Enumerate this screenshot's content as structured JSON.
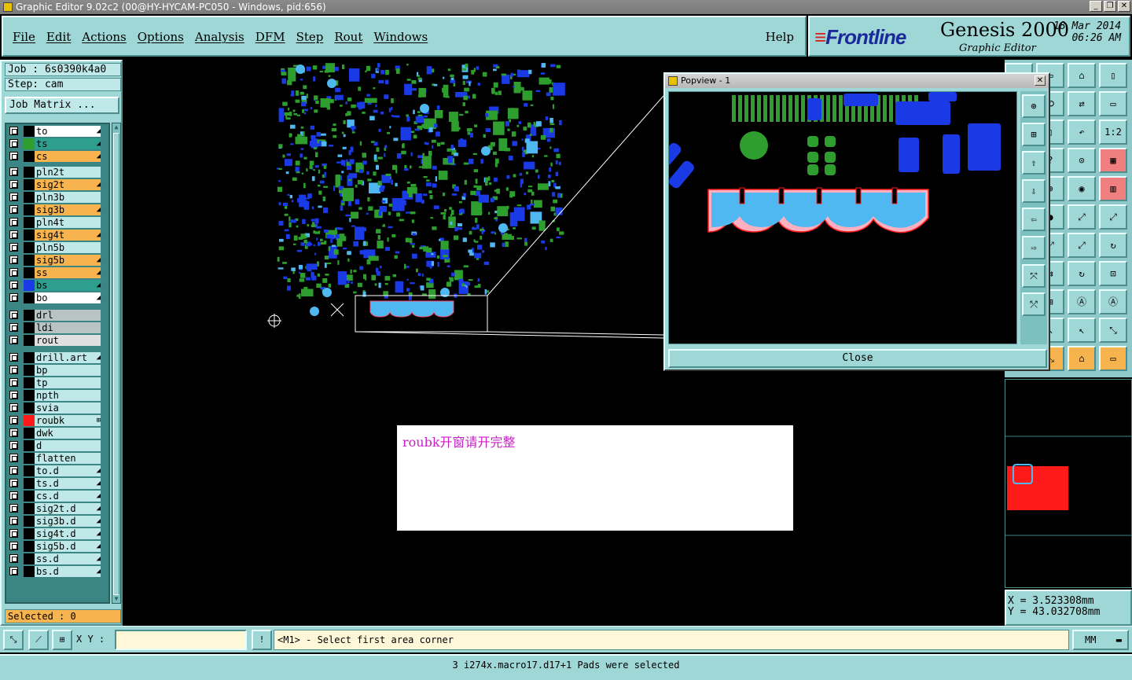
{
  "window": {
    "title": "Graphic Editor 9.02c2 (00@HY-HYCAM-PC050 - Windows, pid:656)"
  },
  "menu": {
    "items": [
      "File",
      "Edit",
      "Actions",
      "Options",
      "Analysis",
      "DFM",
      "Step",
      "Rout",
      "Windows"
    ],
    "help": "Help"
  },
  "brand": {
    "logo": "Frontline",
    "product": "Genesis 2000",
    "subtitle": "Graphic Editor",
    "date": "18 Mar 2014",
    "time": "06:26 AM"
  },
  "job": {
    "job_label": "Job : 6s0390k4a0",
    "step_label": "Step: cam",
    "matrix_button": "Job Matrix ..."
  },
  "layers": [
    {
      "name": "to",
      "color": "#ffffff",
      "swatch": "",
      "icon": "◢"
    },
    {
      "name": "ts",
      "color": "#2e9e8e",
      "swatch": "#2e9e2e",
      "icon": "◢"
    },
    {
      "name": "cs",
      "color": "#f7b34d",
      "swatch": "",
      "icon": "◢"
    },
    {
      "name": "pln2t",
      "color": "#bfe8e8",
      "swatch": "",
      "icon": ""
    },
    {
      "name": "sig2t",
      "color": "#f7b34d",
      "swatch": "",
      "icon": "◢"
    },
    {
      "name": "pln3b",
      "color": "#bfe8e8",
      "swatch": "",
      "icon": ""
    },
    {
      "name": "sig3b",
      "color": "#f7b34d",
      "swatch": "",
      "icon": "◢"
    },
    {
      "name": "pln4t",
      "color": "#bfe8e8",
      "swatch": "",
      "icon": ""
    },
    {
      "name": "sig4t",
      "color": "#f7b34d",
      "swatch": "",
      "icon": "◢"
    },
    {
      "name": "pln5b",
      "color": "#bfe8e8",
      "swatch": "",
      "icon": ""
    },
    {
      "name": "sig5b",
      "color": "#f7b34d",
      "swatch": "",
      "icon": "◢"
    },
    {
      "name": "ss",
      "color": "#f7b34d",
      "swatch": "",
      "icon": "◢"
    },
    {
      "name": "bs",
      "color": "#2e9e8e",
      "swatch": "#1a3ae6",
      "icon": "◢"
    },
    {
      "name": "bo",
      "color": "#ffffff",
      "swatch": "",
      "icon": "◢"
    },
    {
      "name": "drl",
      "color": "#b8c4c4",
      "swatch": "",
      "icon": ""
    },
    {
      "name": "ldi",
      "color": "#b8c4c4",
      "swatch": "",
      "icon": ""
    },
    {
      "name": "rout",
      "color": "#e0e0e0",
      "swatch": "",
      "icon": ""
    },
    {
      "name": "drill.art",
      "color": "#bfe8e8",
      "swatch": "",
      "icon": "◢"
    },
    {
      "name": "bp",
      "color": "#bfe8e8",
      "swatch": "",
      "icon": ""
    },
    {
      "name": "tp",
      "color": "#bfe8e8",
      "swatch": "",
      "icon": ""
    },
    {
      "name": "npth",
      "color": "#bfe8e8",
      "swatch": "",
      "icon": ""
    },
    {
      "name": "svia",
      "color": "#bfe8e8",
      "swatch": "",
      "icon": ""
    },
    {
      "name": "roubk",
      "color": "#bfe8e8",
      "swatch": "#ff1a1a",
      "icon": "⊞"
    },
    {
      "name": "dwk",
      "color": "#bfe8e8",
      "swatch": "",
      "icon": ""
    },
    {
      "name": "d",
      "color": "#bfe8e8",
      "swatch": "",
      "icon": ""
    },
    {
      "name": "flatten",
      "color": "#bfe8e8",
      "swatch": "",
      "icon": ""
    },
    {
      "name": "to.d",
      "color": "#bfe8e8",
      "swatch": "",
      "icon": "◢"
    },
    {
      "name": "ts.d",
      "color": "#bfe8e8",
      "swatch": "",
      "icon": "◢"
    },
    {
      "name": "cs.d",
      "color": "#bfe8e8",
      "swatch": "",
      "icon": "◢"
    },
    {
      "name": "sig2t.d",
      "color": "#bfe8e8",
      "swatch": "",
      "icon": "◢"
    },
    {
      "name": "sig3b.d",
      "color": "#bfe8e8",
      "swatch": "",
      "icon": "◢"
    },
    {
      "name": "sig4t.d",
      "color": "#bfe8e8",
      "swatch": "",
      "icon": "◢"
    },
    {
      "name": "sig5b.d",
      "color": "#bfe8e8",
      "swatch": "",
      "icon": "◢"
    },
    {
      "name": "ss.d",
      "color": "#bfe8e8",
      "swatch": "",
      "icon": "◢"
    },
    {
      "name": "bs.d",
      "color": "#bfe8e8",
      "swatch": "",
      "icon": "◢"
    }
  ],
  "selected_label": "Selected : 0",
  "popview": {
    "title": "Popview - 1",
    "close_button": "Close"
  },
  "note": {
    "text": "roubk开窗请开完整"
  },
  "coords": {
    "x": "X = 3.523308mm",
    "y": "Y = 43.032708mm"
  },
  "command": {
    "xy_label": "X Y :",
    "xy_value": "",
    "prompt": "<M1> - Select first area corner",
    "units": "MM"
  },
  "status": {
    "message": "3 i274x.macro17.d17+1 Pads were selected"
  },
  "colors": {
    "panel": "#9fd6d6",
    "layer_top": "#2e9e2e",
    "layer_bottom": "#1a3ae6",
    "highlight": "#4fb8f0",
    "selection": "#ff1a1a"
  }
}
